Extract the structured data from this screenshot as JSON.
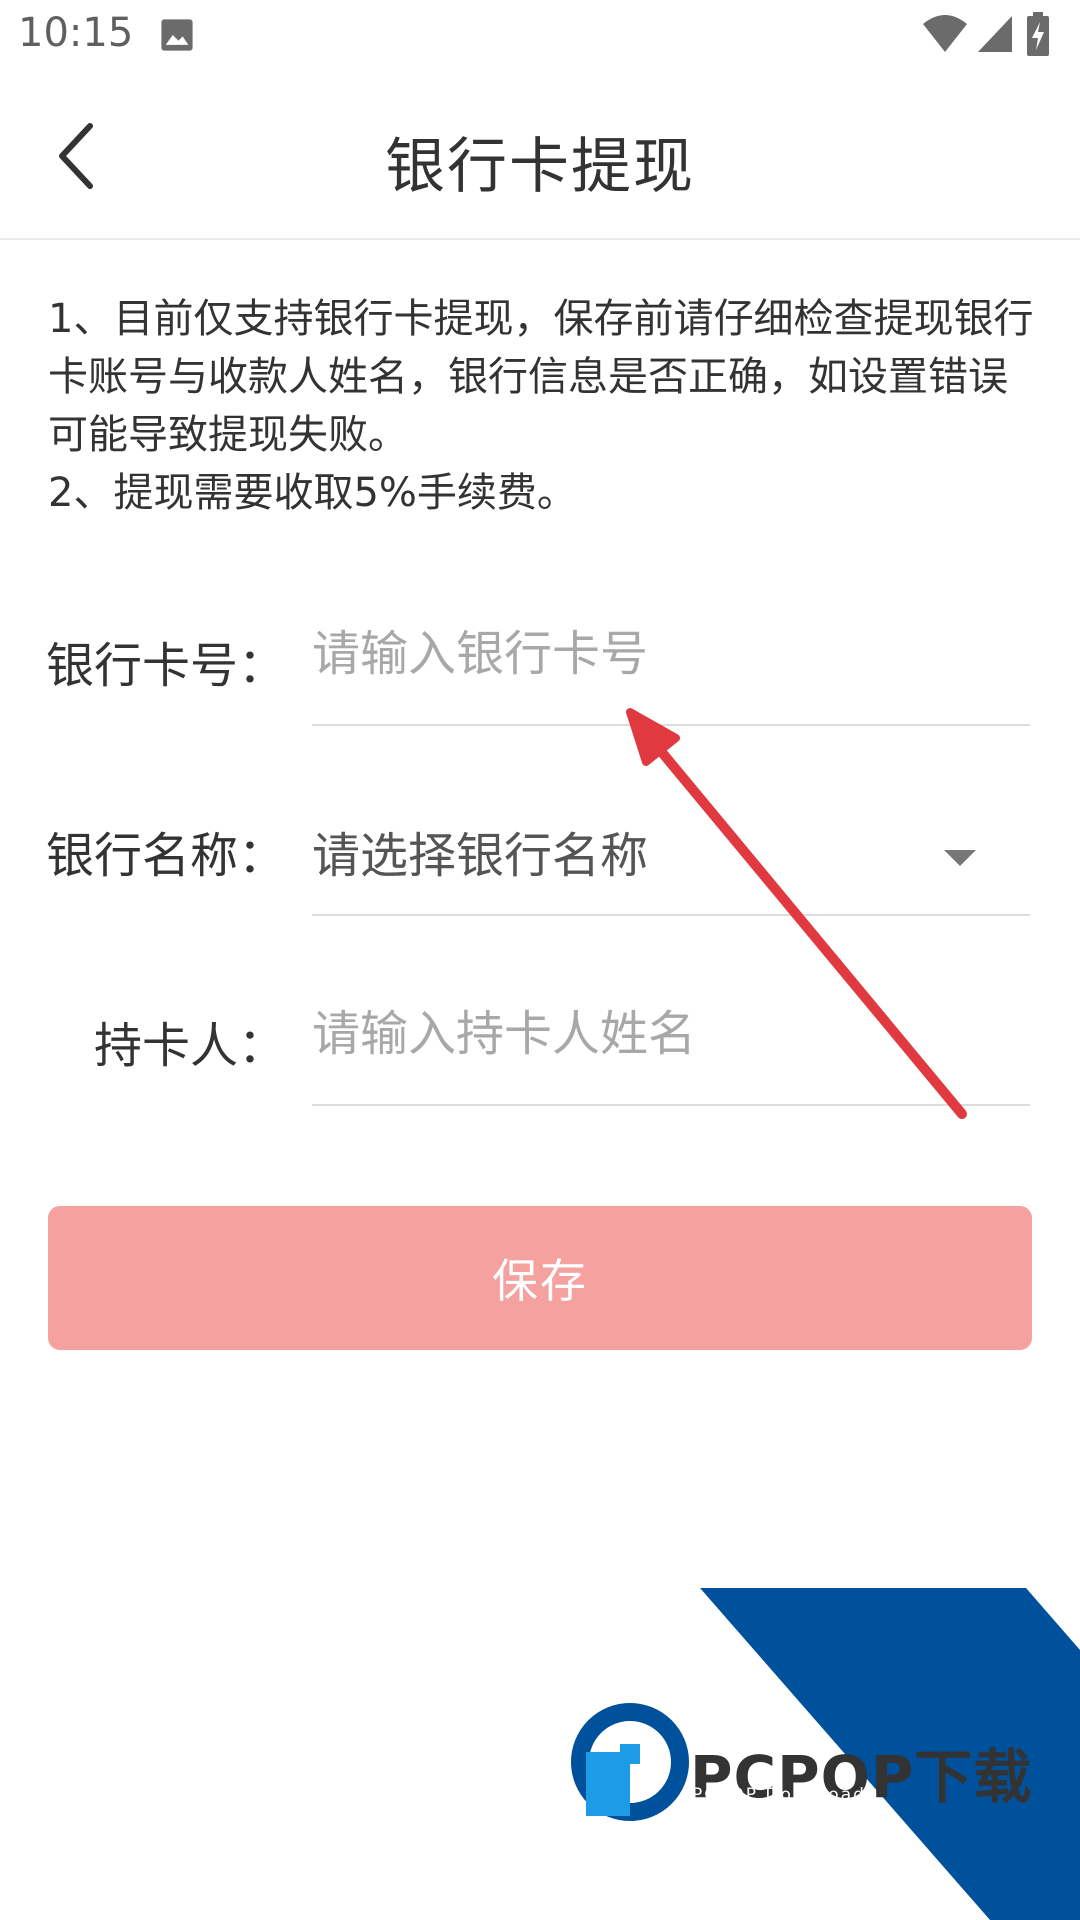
{
  "status_bar": {
    "time": "10:15",
    "icons": [
      "image-icon",
      "wifi-icon",
      "signal-icon",
      "battery-charging-icon"
    ]
  },
  "header": {
    "title": "银行卡提现",
    "back_icon": "chevron-left-icon"
  },
  "notice": {
    "line1": "1、目前仅支持银行卡提现，保存前请仔细检查提现银行卡账号与收款人姓名，银行信息是否正确，如设置错误可能导致提现失败。",
    "line2": "2、提现需要收取5%手续费。"
  },
  "form": {
    "card_number": {
      "label": "银行卡号：",
      "placeholder": "请输入银行卡号",
      "value": ""
    },
    "bank_name": {
      "label": "银行名称：",
      "selected": "请选择银行名称"
    },
    "cardholder": {
      "label": "持卡人：",
      "placeholder": "请输入持卡人姓名",
      "value": ""
    }
  },
  "save_button": {
    "label": "保存"
  },
  "watermark": {
    "text": "PCPOP下载",
    "subtext": "PCPOP Download"
  },
  "colors": {
    "accent_button": "#f5a19f",
    "arrow": "#e0393f",
    "watermark_blue": "#00519b",
    "watermark_light_blue": "#1e9be6"
  }
}
